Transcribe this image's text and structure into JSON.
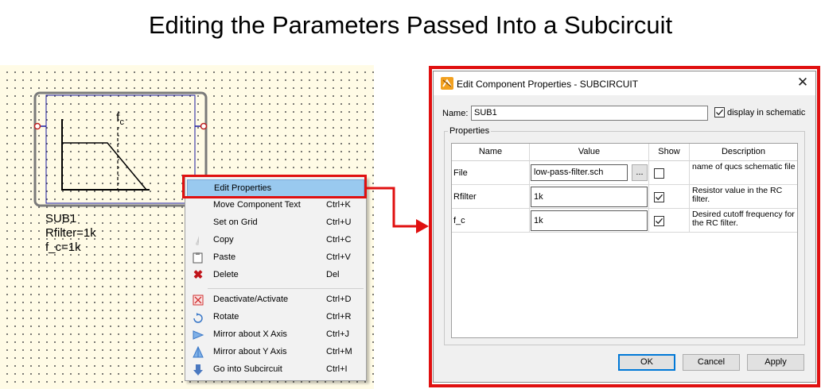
{
  "title": "Editing the Parameters Passed Into a Subcircuit",
  "schematic": {
    "symbol_label": "f",
    "symbol_label_sub": "c",
    "component_lines": [
      "SUB1",
      "Rfilter=1k",
      "f_c=1k"
    ]
  },
  "context_menu": {
    "items": [
      {
        "label": "Edit Properties",
        "shortcut": "",
        "icon": "none"
      },
      {
        "label": "Move Component Text",
        "shortcut": "Ctrl+K",
        "icon": "none"
      },
      {
        "label": "Set on Grid",
        "shortcut": "Ctrl+U",
        "icon": "none"
      },
      {
        "label": "Copy",
        "shortcut": "Ctrl+C",
        "icon": "copy-icon"
      },
      {
        "label": "Paste",
        "shortcut": "Ctrl+V",
        "icon": "paste-icon"
      },
      {
        "label": "Delete",
        "shortcut": "Del",
        "icon": "delete-icon"
      },
      {
        "label": "Deactivate/Activate",
        "shortcut": "Ctrl+D",
        "icon": "deactivate-icon"
      },
      {
        "label": "Rotate",
        "shortcut": "Ctrl+R",
        "icon": "rotate-icon"
      },
      {
        "label": "Mirror about X Axis",
        "shortcut": "Ctrl+J",
        "icon": "mirror-x-icon"
      },
      {
        "label": "Mirror about Y Axis",
        "shortcut": "Ctrl+M",
        "icon": "mirror-y-icon"
      },
      {
        "label": "Go into Subcircuit",
        "shortcut": "Ctrl+I",
        "icon": "go-into-subcircuit-icon"
      }
    ],
    "highlight_color": "#99c9ef"
  },
  "dialog": {
    "title": "Edit Component Properties - SUBCIRCUIT",
    "name_label": "Name:",
    "name_value": "SUB1",
    "display_label": "display in schematic",
    "display_checked": true,
    "group_label": "Properties",
    "columns": [
      "Name",
      "Value",
      "Show",
      "Description"
    ],
    "rows": [
      {
        "name": "File",
        "value": "low-pass-filter.sch",
        "browse": "...",
        "show": false,
        "description": "name of qucs schematic file"
      },
      {
        "name": "Rfilter",
        "value": "1k",
        "show": true,
        "description": "Resistor value in the RC filter."
      },
      {
        "name": "f_c",
        "value": "1k",
        "show": true,
        "description": "Desired cutoff frequency for the RC filter."
      }
    ],
    "buttons": {
      "ok": "OK",
      "cancel": "Cancel",
      "apply": "Apply"
    }
  },
  "colors": {
    "accent_red": "#e01010",
    "grid_bg": "#fffbe6",
    "wire_blue": "#1a1aa0"
  }
}
